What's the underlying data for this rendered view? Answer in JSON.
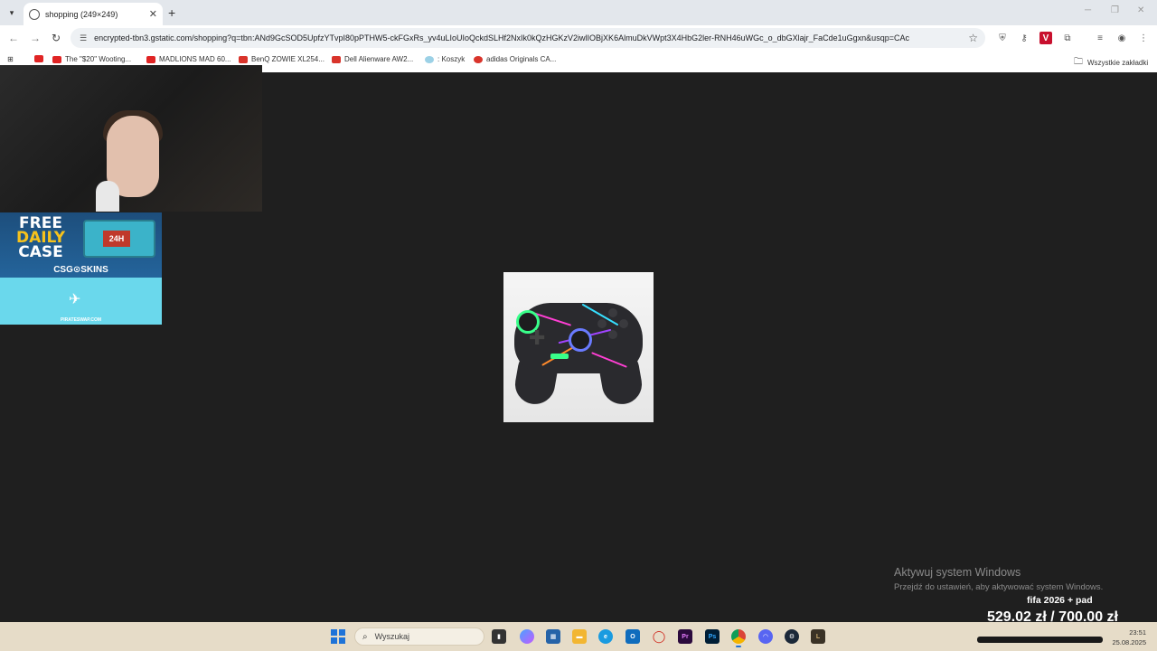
{
  "browser": {
    "tab_title": "shopping (249×249)",
    "url": "encrypted-tbn3.gstatic.com/shopping?q=tbn:ANd9GcSOD5UpfzYTvpI80pPTHW5-ckFGxRs_yv4uLIoUIoQckdSLHf2NxIk0kQzHGKzV2iwlIOBjXK6AlmuDkVWpt3X4HbG2ler-RNH46uWGc_o_dbGXlajr_FaCde1uGgxn&usqp=CAc",
    "bookmarks": [
      {
        "label": "The \"$20\" Wooting...",
        "color": "#e02424"
      },
      {
        "label": "MADLIONS MAD 60...",
        "color": "#e02424"
      },
      {
        "label": "BenQ ZOWIE XL254...",
        "color": "#d9342b"
      },
      {
        "label": "Dell Alienware AW2...",
        "color": "#d9342b"
      },
      {
        "label": ": Koszyk",
        "color": "#9cd1e6"
      },
      {
        "label": "adidas Originals CA...",
        "color": "#d9342b"
      }
    ],
    "all_bookmarks_label": "Wszystkie zakładki"
  },
  "overlay": {
    "ad": {
      "free": "FREE",
      "daily": "DAILY",
      "case": "CASE",
      "timer": "24H",
      "brand": "CSG⊙SKINS",
      "site": "PIRATESWAP.COM"
    },
    "stream_label": "fifa 2026 + pad",
    "stream_price": "529.02 zł / 700.00 zł"
  },
  "watermark": {
    "title": "Aktywuj system Windows",
    "subtitle": "Przejdź do ustawień, aby aktywować system Windows."
  },
  "taskbar": {
    "search_label": "Wyszukaj",
    "time": "23:51",
    "date": "25.08.2025"
  }
}
